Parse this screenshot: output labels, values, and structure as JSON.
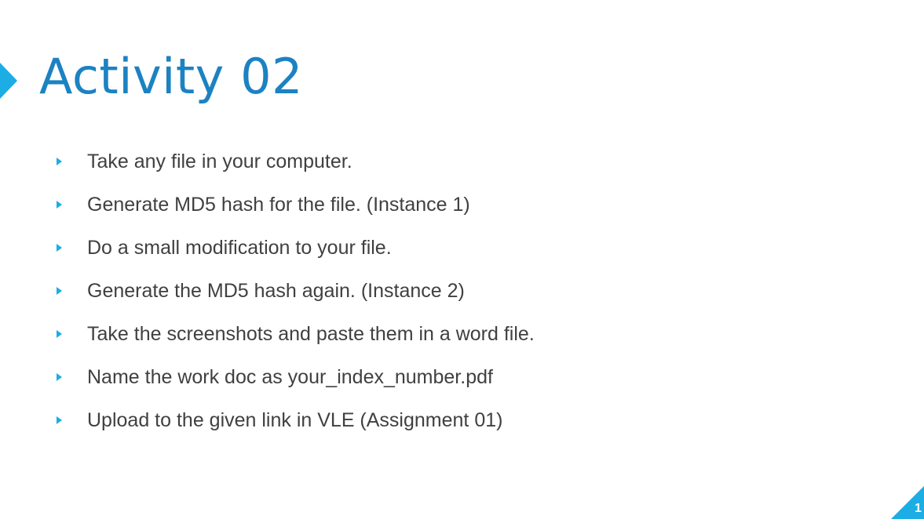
{
  "slide": {
    "title": "Activity 02",
    "bullets": [
      "Take any file in your computer.",
      "Generate MD5 hash for the file. (Instance 1)",
      "Do a small modification to your file.",
      "Generate the MD5 hash again. (Instance 2)",
      "Take the screenshots and paste them in a word file.",
      "Name the work doc as your_index_number.pdf",
      "Upload to the given link in VLE (Assignment 01)"
    ],
    "slide_number": "1"
  },
  "colors": {
    "accent": "#1cade4",
    "title": "#1c82c2",
    "body_text": "#404040",
    "background": "#ffffff"
  },
  "icons": {
    "title_marker": "triangle-right-icon",
    "bullet": "triangle-bullet-icon"
  }
}
